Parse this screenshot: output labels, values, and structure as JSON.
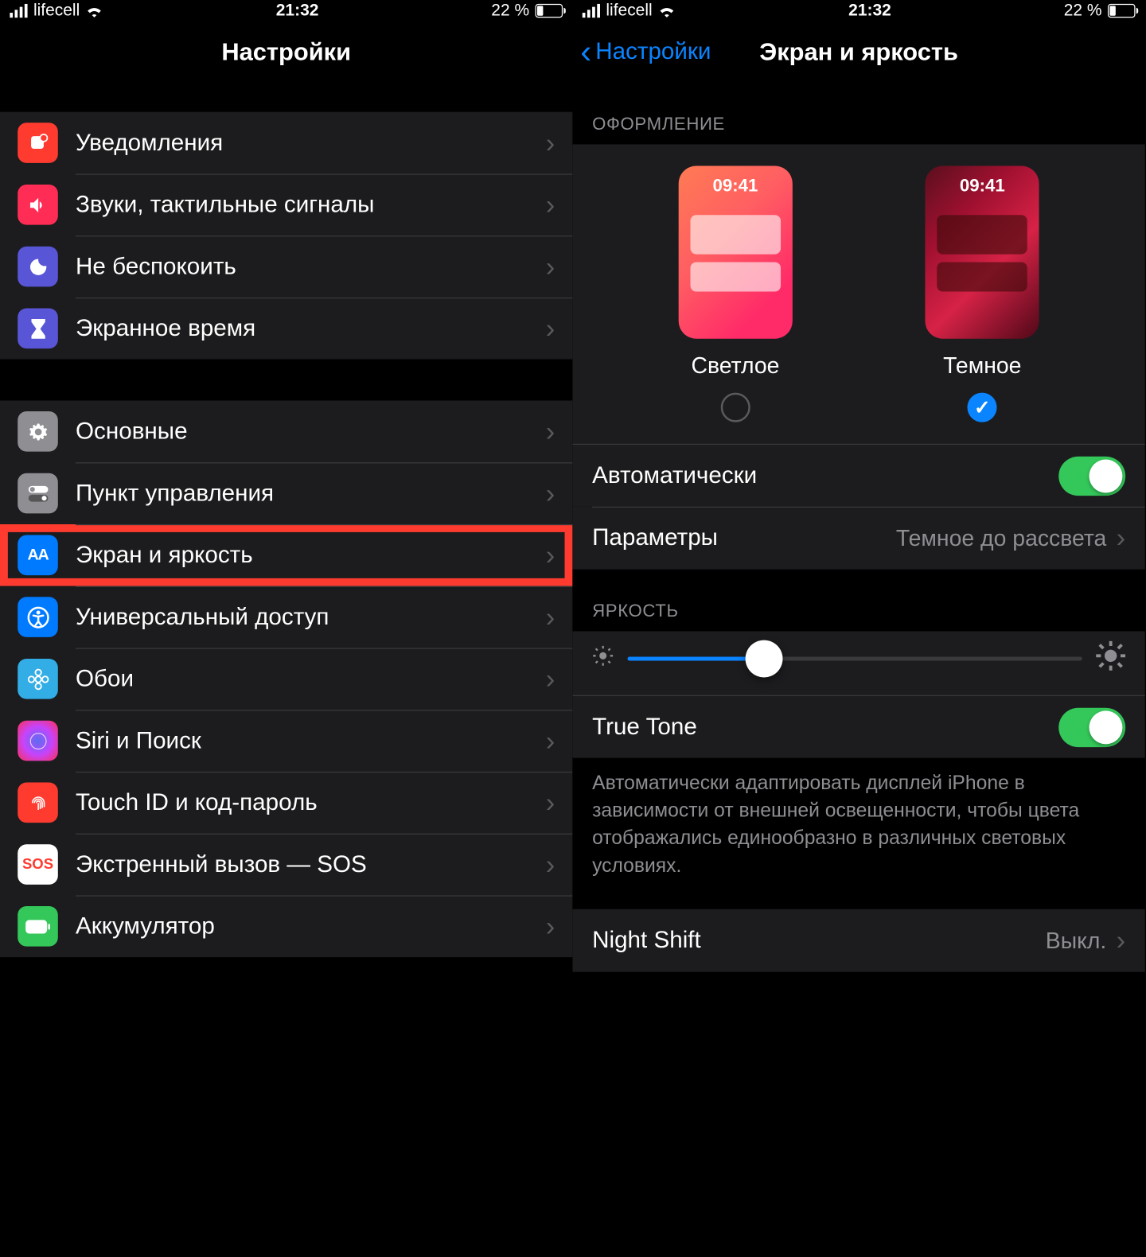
{
  "status": {
    "carrier": "lifecell",
    "time": "21:32",
    "battery_pct": "22 %"
  },
  "left": {
    "title": "Настройки",
    "rows_a": [
      {
        "key": "notifications",
        "label": "Уведомления"
      },
      {
        "key": "sounds",
        "label": "Звуки, тактильные сигналы"
      },
      {
        "key": "dnd",
        "label": "Не беспокоить"
      },
      {
        "key": "screentime",
        "label": "Экранное время"
      }
    ],
    "rows_b": [
      {
        "key": "general",
        "label": "Основные"
      },
      {
        "key": "controlcenter",
        "label": "Пункт управления"
      },
      {
        "key": "display",
        "label": "Экран и яркость"
      },
      {
        "key": "accessibility",
        "label": "Универсальный доступ"
      },
      {
        "key": "wallpaper",
        "label": "Обои"
      },
      {
        "key": "siri",
        "label": "Siri и Поиск"
      },
      {
        "key": "touchid",
        "label": "Touch ID и код-пароль"
      },
      {
        "key": "sos",
        "label": "Экстренный вызов — SOS"
      },
      {
        "key": "battery",
        "label": "Аккумулятор"
      }
    ]
  },
  "right": {
    "back": "Настройки",
    "title": "Экран и яркость",
    "appearance_header": "ОФОРМЛЕНИЕ",
    "preview_time": "09:41",
    "light_label": "Светлое",
    "dark_label": "Темное",
    "auto_label": "Автоматически",
    "params_label": "Параметры",
    "params_value": "Темное до рассвета",
    "brightness_header": "ЯРКОСТЬ",
    "truetone_label": "True Tone",
    "truetone_desc": "Автоматически адаптировать дисплей iPhone в зависимости от внешней освещенности, чтобы цвета отображались единообразно в различных световых условиях.",
    "nightshift_label": "Night Shift",
    "nightshift_value": "Выкл."
  }
}
